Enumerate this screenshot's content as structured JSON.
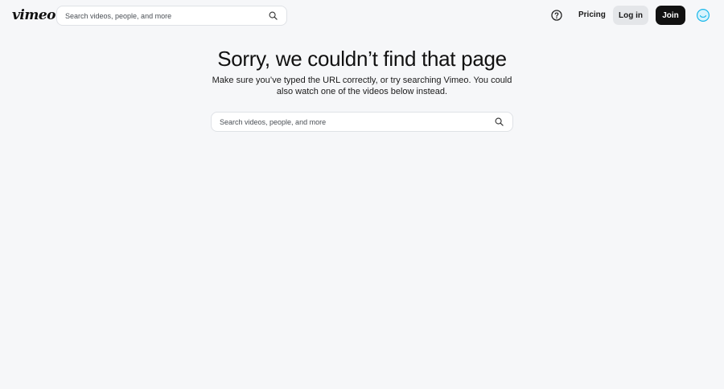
{
  "header": {
    "logo": "vimeo",
    "search_placeholder": "Search videos, people, and more",
    "help_icon": "help-circle-icon",
    "pricing_label": "Pricing",
    "login_label": "Log in",
    "join_label": "Join",
    "avatar_color": "#19b7ea"
  },
  "main": {
    "title": "Sorry, we couldn’t find that page",
    "subtitle": "Make sure you’ve typed the URL correctly, or try searching Vimeo. You could also watch one of the videos below instead.",
    "search_placeholder": "Search videos, people, and more"
  }
}
